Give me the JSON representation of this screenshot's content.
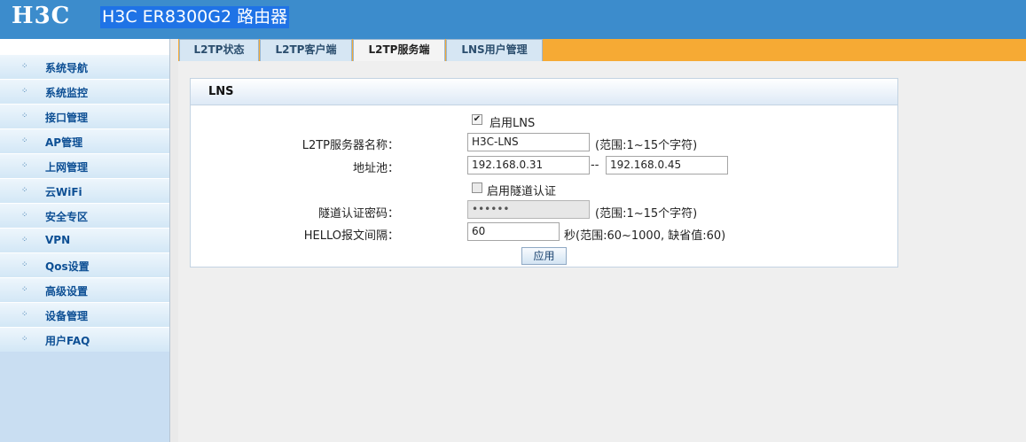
{
  "header": {
    "logo_text": "H3C",
    "title": "H3C ER8300G2 路由器"
  },
  "sidebar": {
    "items": [
      {
        "label": "系统导航"
      },
      {
        "label": "系统监控"
      },
      {
        "label": "接口管理"
      },
      {
        "label": "AP管理"
      },
      {
        "label": "上网管理"
      },
      {
        "label": "云WiFi"
      },
      {
        "label": "安全专区"
      },
      {
        "label": "VPN"
      },
      {
        "label": "Qos设置"
      },
      {
        "label": "高级设置"
      },
      {
        "label": "设备管理"
      },
      {
        "label": "用户FAQ"
      }
    ]
  },
  "tabs": [
    {
      "label": "L2TP状态",
      "active": false
    },
    {
      "label": "L2TP客户端",
      "active": false
    },
    {
      "label": "L2TP服务端",
      "active": true
    },
    {
      "label": "LNS用户管理",
      "active": false
    }
  ],
  "panel": {
    "title": "LNS",
    "enable_lns": {
      "label": "启用LNS",
      "checked": true
    },
    "server_name": {
      "label": "L2TP服务器名称：",
      "value": "H3C-LNS",
      "hint": "(范围:1~15个字符)"
    },
    "address_pool": {
      "label": "地址池：",
      "start": "192.168.0.31",
      "separator": "--",
      "end": "192.168.0.45"
    },
    "tunnel_auth": {
      "label": "启用隧道认证",
      "checked": false
    },
    "tunnel_password": {
      "label": "隧道认证密码：",
      "value": "••••••",
      "hint": "(范围:1~15个字符)"
    },
    "hello_interval": {
      "label": "HELLO报文间隔：",
      "value": "60",
      "hint": "秒(范围:60~1000, 缺省值:60)"
    },
    "apply_label": "应用"
  },
  "colors": {
    "header_bg": "#3c8ccc",
    "tab_strip": "#f6aa34",
    "nav_text": "#0d4f94"
  }
}
